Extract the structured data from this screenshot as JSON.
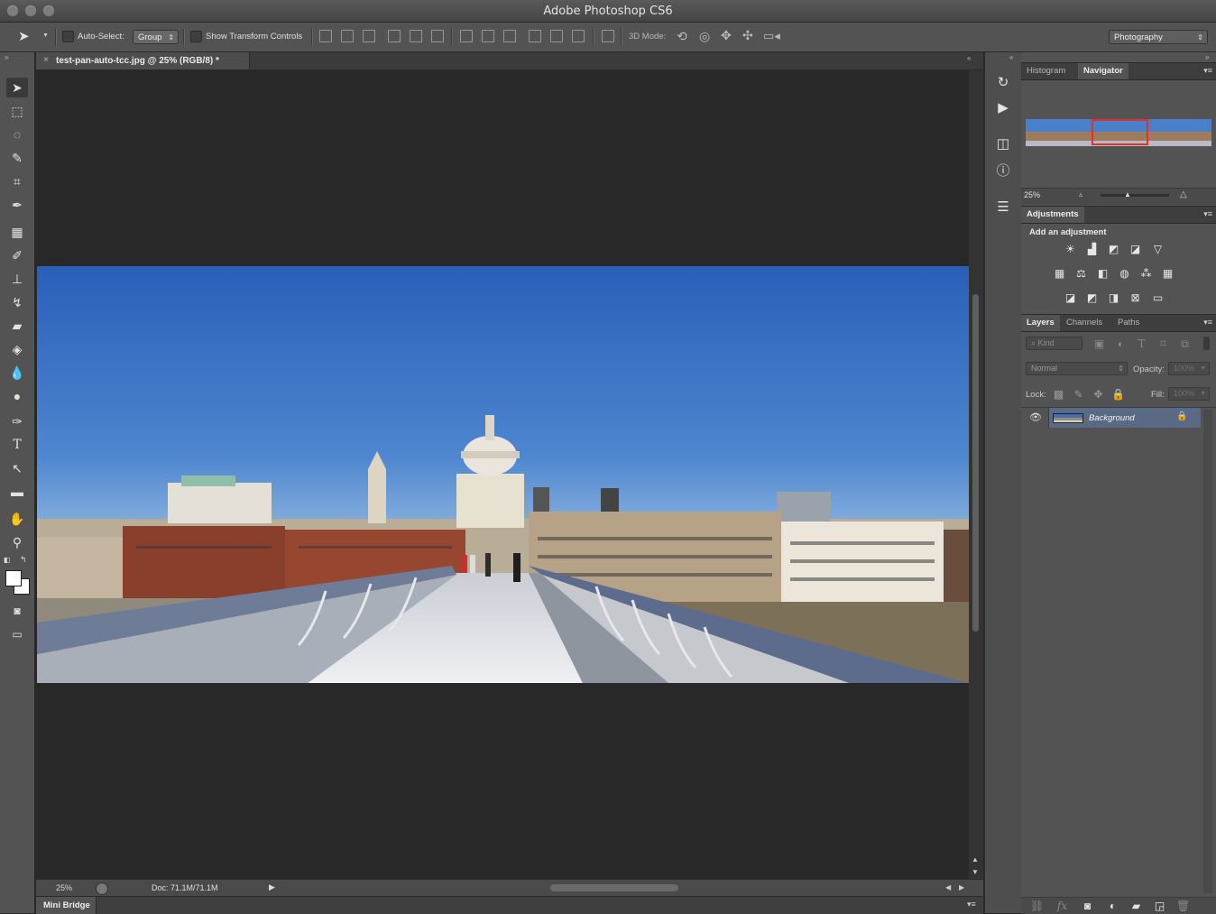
{
  "app": {
    "title": "Adobe Photoshop CS6"
  },
  "options_bar": {
    "auto_select_label": "Auto-Select:",
    "auto_select_value": "Group",
    "show_transform_label": "Show Transform Controls",
    "mode_3d_label": "3D Mode:",
    "workspace_value": "Photography"
  },
  "document": {
    "tab_label": "test-pan-auto-tcc.jpg @ 25% (RGB/8) *",
    "close_glyph": "×",
    "zoom_status": "25%",
    "doc_size": "Doc: 71.1M/71.1M"
  },
  "mini_bridge": {
    "label": "Mini Bridge"
  },
  "navigator": {
    "tabs": [
      "Histogram",
      "Navigator"
    ],
    "active_tab": "Navigator",
    "zoom_value": "25%"
  },
  "adjustments": {
    "tab": "Adjustments",
    "heading": "Add an adjustment",
    "row1": [
      "brightness-contrast-icon",
      "levels-icon",
      "curves-icon",
      "exposure-icon",
      "vibrance-icon"
    ],
    "row2": [
      "hue-saturation-icon",
      "color-balance-icon",
      "black-white-icon",
      "photo-filter-icon",
      "channel-mixer-icon",
      "color-lookup-icon"
    ],
    "row3": [
      "invert-icon",
      "posterize-icon",
      "threshold-icon",
      "selective-color-icon",
      "gradient-map-icon"
    ]
  },
  "layers": {
    "tabs": [
      "Layers",
      "Channels",
      "Paths"
    ],
    "active_tab": "Layers",
    "filter_kind": "Kind",
    "blend_mode": "Normal",
    "opacity_label": "Opacity:",
    "opacity_value": "100%",
    "lock_label": "Lock:",
    "fill_label": "Fill:",
    "fill_value": "100%",
    "items": [
      {
        "name": "Background",
        "visible": true,
        "locked": true
      }
    ]
  },
  "colors": {
    "ui_bg": "#535353",
    "canvas_bg": "#282828",
    "selection": "#5a6a84",
    "navigator_frame": "#e03030"
  }
}
